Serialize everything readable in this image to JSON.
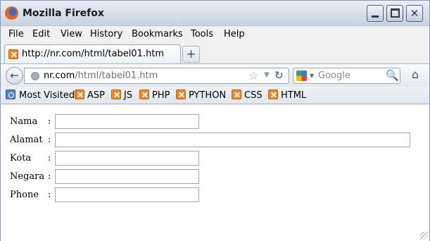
{
  "window": {
    "title": "Mozilla Firefox"
  },
  "menubar": {
    "items": [
      {
        "label": "File"
      },
      {
        "label": "Edit"
      },
      {
        "label": "View"
      },
      {
        "label": "History"
      },
      {
        "label": "Bookmarks"
      },
      {
        "label": "Tools"
      },
      {
        "label": "Help"
      }
    ]
  },
  "tabs": [
    {
      "label": "http://nr.com/html/tabel01.htm",
      "icon": "xampp-icon"
    }
  ],
  "navbar": {
    "url_domain": "nr.com",
    "url_path": "/html/tabel01.htm",
    "search_placeholder": "Google"
  },
  "bookmarks": [
    {
      "label": "Most Visited",
      "icon": "most-visited-icon"
    },
    {
      "label": "ASP",
      "icon": "xampp-icon"
    },
    {
      "label": "JS",
      "icon": "xampp-icon"
    },
    {
      "label": "PHP",
      "icon": "xampp-icon"
    },
    {
      "label": "PYTHON",
      "icon": "xampp-icon"
    },
    {
      "label": "CSS",
      "icon": "xampp-icon"
    },
    {
      "label": "HTML",
      "icon": "xampp-icon"
    }
  ],
  "form": {
    "rows": [
      {
        "label": "Nama",
        "colon": ":",
        "value": "",
        "size": "short"
      },
      {
        "label": "Alamat",
        "colon": ":",
        "value": "",
        "size": "long"
      },
      {
        "label": "Kota",
        "colon": ":",
        "value": "",
        "size": "short"
      },
      {
        "label": "Negara",
        "colon": ":",
        "value": "",
        "size": "short"
      },
      {
        "label": "Phone",
        "colon": ":",
        "value": "",
        "size": "short"
      }
    ]
  }
}
